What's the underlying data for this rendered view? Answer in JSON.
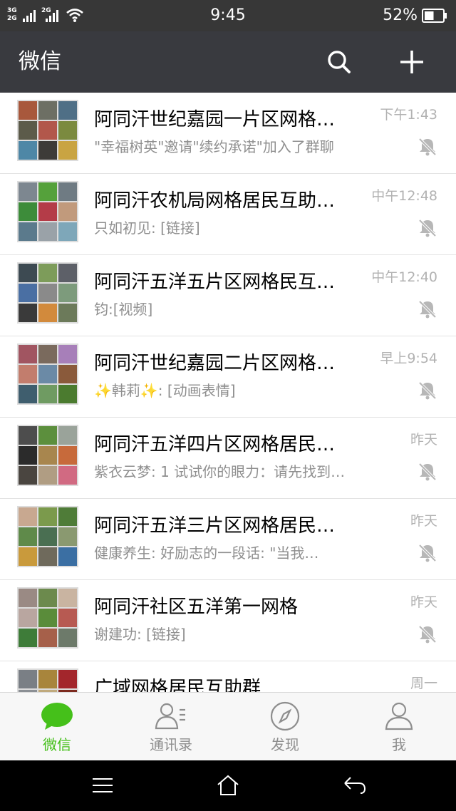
{
  "status_bar": {
    "network_top": "3G",
    "network_bottom": "2G",
    "network_second": "2G",
    "time": "9:45",
    "battery_percent": "52%",
    "battery_level": 0.52
  },
  "header": {
    "title": "微信",
    "search_icon": "search-icon",
    "add_icon": "plus-icon"
  },
  "chats": [
    {
      "title": "阿同汗世纪嘉园一片区网格…",
      "time": "下午1:43",
      "preview": "\"幸福树英\"邀请\"续约承诺\"加入了群聊",
      "muted": true,
      "avatar_colors": [
        "#a8583c",
        "#6d6f64",
        "#4f6f86",
        "#5c5b4a",
        "#b2574b",
        "#7b8a3f",
        "#4e87a6",
        "#3d3b38",
        "#c9a442"
      ]
    },
    {
      "title": "阿同汗农机局网格居民互助…",
      "time": "中午12:48",
      "preview": "只如初见: [链接]",
      "muted": true,
      "avatar_colors": [
        "#7d8790",
        "#55a13b",
        "#6f7b83",
        "#3d8c3a",
        "#b43c48",
        "#c19a7c",
        "#5b7a8c",
        "#9aa2a8",
        "#7ea7b9"
      ]
    },
    {
      "title": "阿同汗五洋五片区网格民互…",
      "time": "中午12:40",
      "preview": "钧:[视频]",
      "muted": true,
      "avatar_colors": [
        "#3d4a52",
        "#7d9c5a",
        "#5d6068",
        "#4a6fa3",
        "#8a8a8a",
        "#7d9b7c",
        "#3a3a3a",
        "#d28a3c",
        "#6c7a5a"
      ]
    },
    {
      "title": "阿同汗世纪嘉园二片区网格…",
      "time": "早上9:54",
      "preview": "✨韩莉✨: [动画表情]",
      "muted": true,
      "avatar_colors": [
        "#a15561",
        "#7a6a5d",
        "#a77fb9",
        "#c27d6d",
        "#6b8aa6",
        "#8a5a3b",
        "#3f5e6e",
        "#6f9b62",
        "#4b7b2f"
      ]
    },
    {
      "title": "阿同汗五洋四片区网格居民…",
      "time": "昨天",
      "preview": "紫衣云梦: 1 试试你的眼力：请先找到…",
      "muted": true,
      "avatar_colors": [
        "#4d4d4d",
        "#5c8f3d",
        "#9aa39a",
        "#2b2b2b",
        "#a8864e",
        "#c76a3b",
        "#4a4540",
        "#b09d83",
        "#d16a82"
      ]
    },
    {
      "title": "阿同汗五洋三片区网格居民…",
      "time": "昨天",
      "preview": "健康养生: 好励志的一段话:       \"当我…",
      "muted": true,
      "avatar_colors": [
        "#c8a890",
        "#7b9a4c",
        "#4f7c38",
        "#5f8a4a",
        "#4a6f52",
        "#8a9970",
        "#c99a3c",
        "#6f6a5c",
        "#3b6fa3"
      ]
    },
    {
      "title": "阿同汗社区五洋第一网格",
      "time": "昨天",
      "preview": "谢建功: [链接]",
      "muted": true,
      "avatar_colors": [
        "#9a8a84",
        "#6c8a4d",
        "#c9b4a1",
        "#b9a6a0",
        "#5a8c3a",
        "#b75a52",
        "#3e7c39",
        "#a6604a",
        "#6d7a6a"
      ]
    },
    {
      "title": "广域网格居民互助群",
      "time": "周一",
      "preview": "",
      "muted": false,
      "avatar_colors": [
        "#7a7f85",
        "#a8853c",
        "#a3262c",
        "#8b8f94",
        "#c0aa7d",
        "#7c2a1e",
        "#6b6f74",
        "#d5c29a",
        "#5a4234"
      ]
    }
  ],
  "tabs": [
    {
      "label": "微信",
      "icon": "chat-bubble-icon",
      "active": true
    },
    {
      "label": "通讯录",
      "icon": "contacts-icon",
      "active": false
    },
    {
      "label": "发现",
      "icon": "compass-icon",
      "active": false
    },
    {
      "label": "我",
      "icon": "person-icon",
      "active": false
    }
  ],
  "nav_bar": {
    "menu_icon": "menu-icon",
    "home_icon": "home-icon",
    "back_icon": "back-icon"
  },
  "colors": {
    "header_bg": "#393a3f",
    "accent_green": "#45c01a",
    "muted_gray": "#b2b2b2"
  }
}
